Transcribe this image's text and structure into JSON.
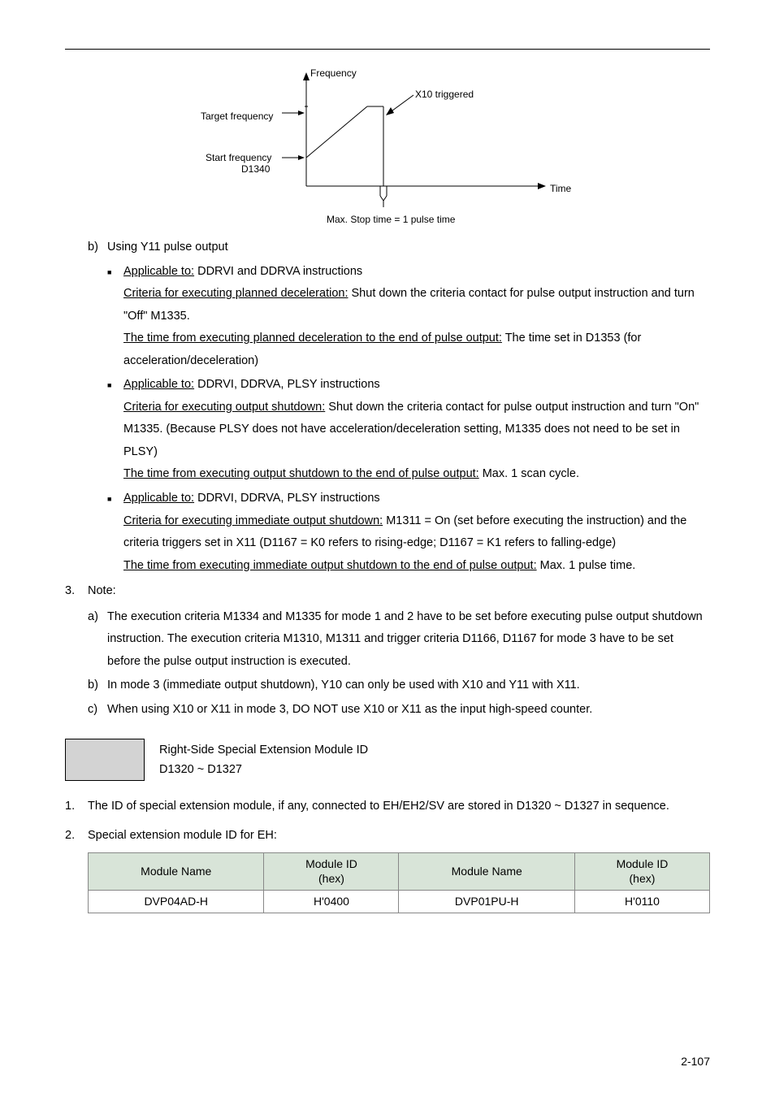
{
  "diagram": {
    "y_axis": "Frequency",
    "x_axis": "Time",
    "trigger": "X10 triggered",
    "target": "Target frequency",
    "start": "Start frequency",
    "start_reg": "D1340",
    "caption": "Max. Stop time = 1 pulse time"
  },
  "item_b": {
    "marker": "b)",
    "text": "Using Y11 pulse output"
  },
  "bul1": {
    "l1_u": "Applicable to:",
    "l1_t": " DDRVI and DDRVA instructions",
    "l2_u": "Criteria for executing planned deceleration:",
    "l2_t": " Shut down the criteria contact for pulse output instruction and turn \"Off\" M1335.",
    "l3_u": "The time from executing planned deceleration to the end of pulse output:",
    "l3_t": " The time set in D1353 (for acceleration/deceleration)"
  },
  "bul2": {
    "l1_u": "Applicable to:",
    "l1_t": " DDRVI, DDRVA, PLSY instructions",
    "l2_u": "Criteria for executing output shutdown:",
    "l2_t": " Shut down the criteria contact for pulse output instruction and turn \"On\" M1335. (Because PLSY does not have acceleration/deceleration setting, M1335 does not need to be set in PLSY)",
    "l3_u": "The time from executing output shutdown to the end of pulse output:",
    "l3_t": " Max. 1 scan cycle."
  },
  "bul3": {
    "l1_u": "Applicable to:",
    "l1_t": " DDRVI, DDRVA, PLSY instructions",
    "l2_u": "Criteria for executing immediate output shutdown:",
    "l2_t": " M1311 = On (set before executing the instruction) and the criteria triggers set in X11 (D1167 = K0 refers to rising-edge; D1167 = K1 refers to falling-edge)",
    "l3_u": "The time from executing immediate output shutdown to the end of pulse output:",
    "l3_t": " Max. 1 pulse time."
  },
  "note": {
    "marker": "3.",
    "title": "Note:",
    "a_m": "a)",
    "a_t": "The execution criteria M1334 and M1335 for mode 1 and 2 have to be set before executing pulse output shutdown instruction. The execution criteria M1310, M1311 and trigger criteria D1166, D1167 for mode 3 have to be set before the pulse output instruction is executed.",
    "b_m": "b)",
    "b_t": "In mode 3 (immediate output shutdown), Y10 can only be used with X10 and Y11 with X11.",
    "c_m": "c)",
    "c_t": "When using X10 or X11 in mode 3, DO NOT use X10 or X11 as the input high-speed counter."
  },
  "section": {
    "title1": "Right-Side Special Extension Module ID",
    "title2": "D1320 ~ D1327"
  },
  "list2": {
    "i1_m": "1.",
    "i1_t": "The ID of special extension module, if any, connected to EH/EH2/SV are stored in D1320 ~ D1327 in sequence.",
    "i2_m": "2.",
    "i2_t": "Special extension module ID for EH:"
  },
  "table": {
    "h1": "Module Name",
    "h2": "Module ID\n(hex)",
    "h3": "Module Name",
    "h4": "Module ID\n(hex)",
    "r1c1": "DVP04AD-H",
    "r1c2": "H'0400",
    "r1c3": "DVP01PU-H",
    "r1c4": "H'0110"
  },
  "pagenum": "2-107"
}
